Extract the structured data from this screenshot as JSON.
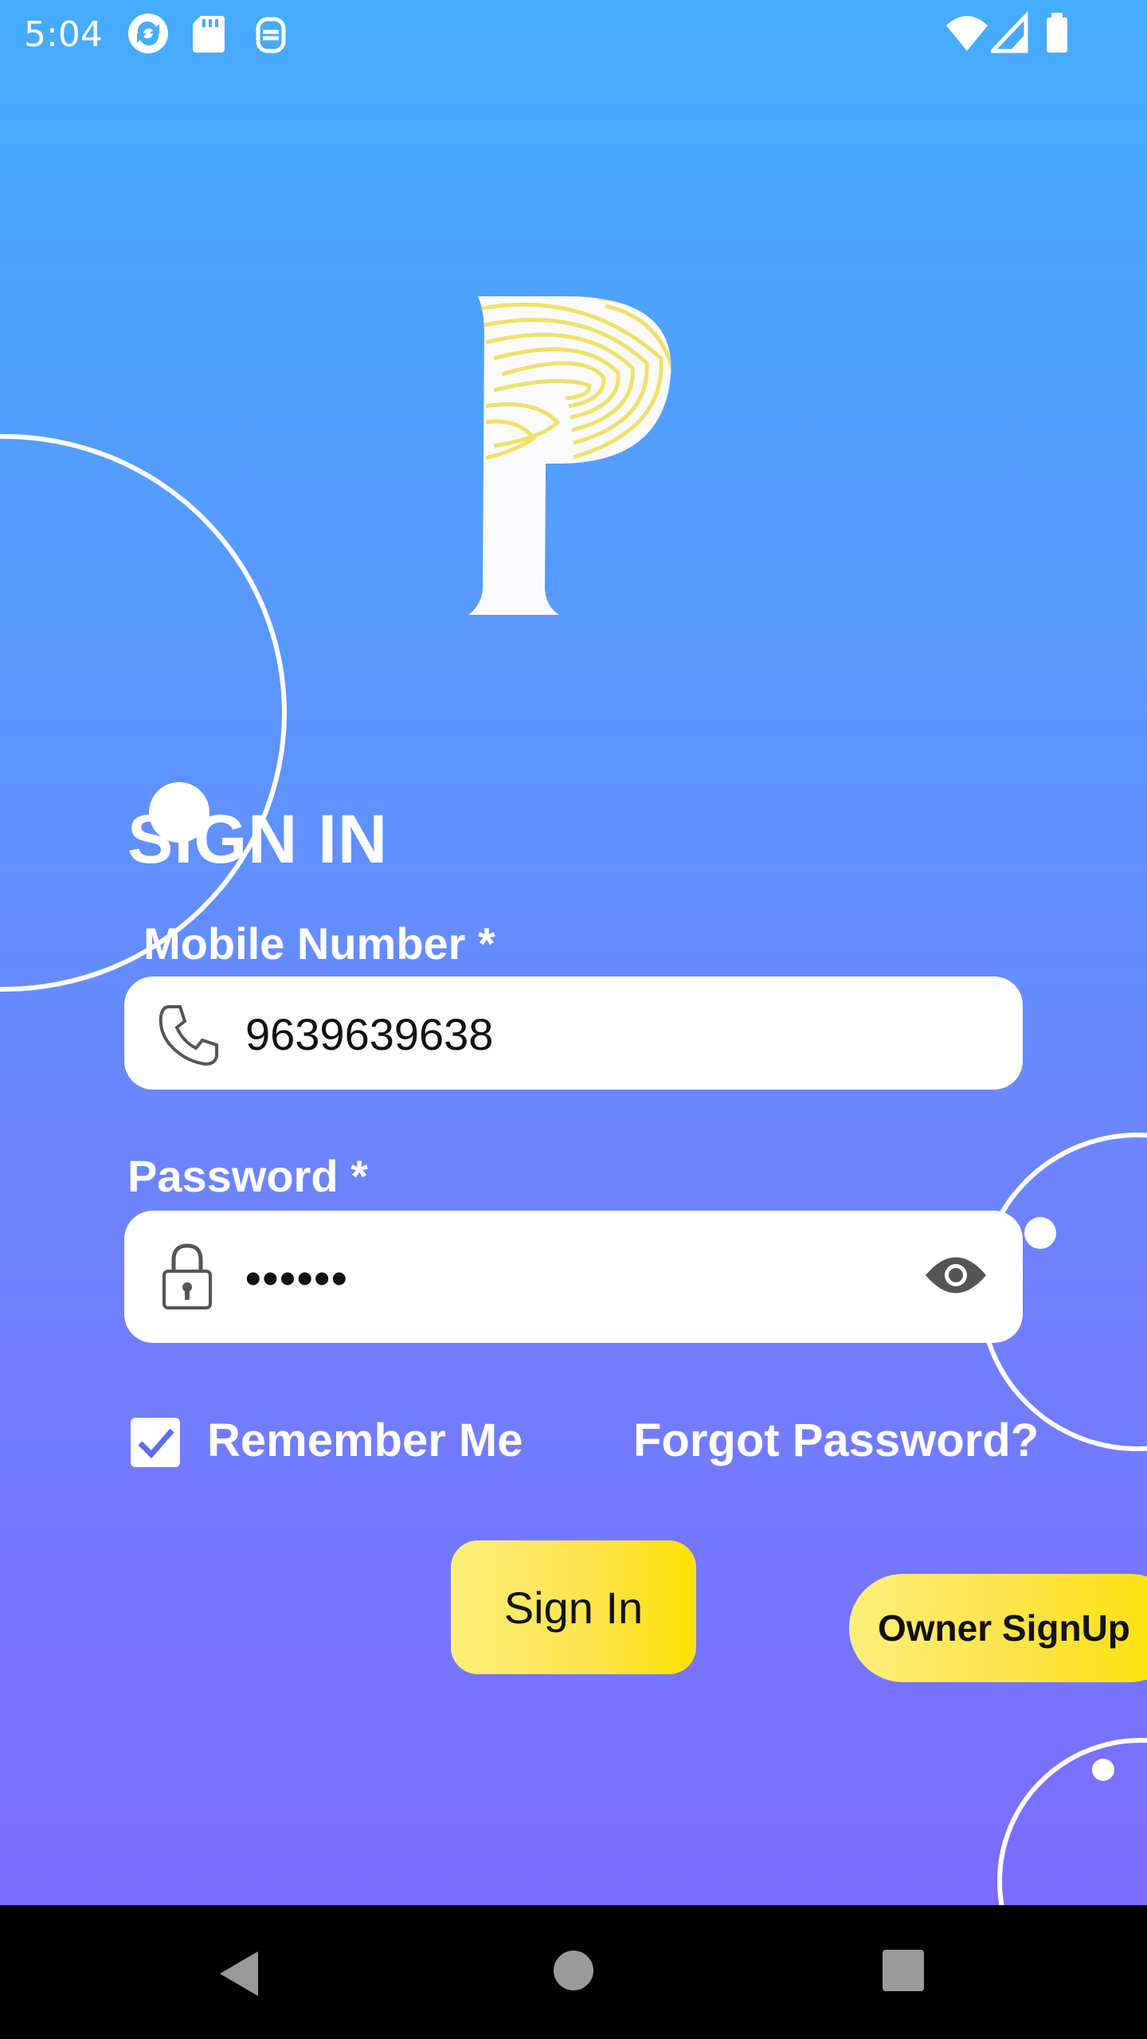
{
  "status_bar": {
    "time": "5:04",
    "left_icons": [
      "sync-icon",
      "sd-card-icon",
      "accessibility-icon"
    ],
    "right_icons": [
      "wifi-icon",
      "signal-icon",
      "battery-icon"
    ]
  },
  "brand": {
    "logo_icon": "fingerprint-p-logo"
  },
  "form": {
    "title": "SIGN IN",
    "mobile_label": "Mobile Number *",
    "mobile_value": "9639639638",
    "password_label": "Password *",
    "password_value": "••••••",
    "remember_label": "Remember Me",
    "remember_checked": true,
    "forgot_label": "Forgot Password?",
    "signin_label": "Sign In",
    "owner_signup_label": "Owner SignUp"
  },
  "colors": {
    "gradient_top": "#45acff",
    "gradient_bottom": "#7c6cff",
    "button_yellow": "#fde100",
    "checkbox_check": "#5a6cf0"
  },
  "nav_bar": {
    "icons": [
      "back-icon",
      "home-icon",
      "recents-icon"
    ]
  }
}
